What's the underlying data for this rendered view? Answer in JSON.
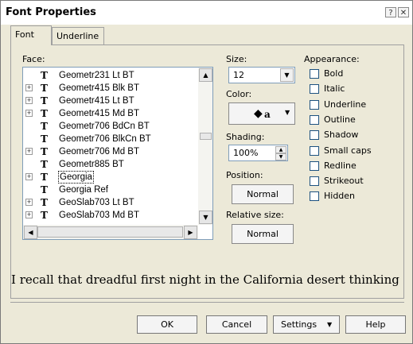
{
  "window": {
    "title": "Font Properties",
    "help_glyph": "?",
    "close_glyph": "✕"
  },
  "tabs": [
    {
      "label": "Font"
    },
    {
      "label": "Underline"
    }
  ],
  "face": {
    "label": "Face:",
    "items": [
      {
        "name": "Geometr231 Lt BT",
        "expand": ""
      },
      {
        "name": "Geometr415 Blk BT",
        "expand": "+"
      },
      {
        "name": "Geometr415 Lt BT",
        "expand": "+"
      },
      {
        "name": "Geometr415 Md BT",
        "expand": "+"
      },
      {
        "name": "Geometr706 BdCn BT",
        "expand": ""
      },
      {
        "name": "Geometr706 BlkCn BT",
        "expand": ""
      },
      {
        "name": "Geometr706 Md BT",
        "expand": "+"
      },
      {
        "name": "Geometr885 BT",
        "expand": ""
      },
      {
        "name": "Georgia",
        "expand": "+",
        "selected": true
      },
      {
        "name": "Georgia Ref",
        "expand": ""
      },
      {
        "name": "GeoSlab703 Lt BT",
        "expand": "+"
      },
      {
        "name": "GeoSlab703 Md BT",
        "expand": "+"
      }
    ],
    "tt_glyph": "T"
  },
  "size": {
    "label": "Size:",
    "value": "12"
  },
  "color": {
    "label": "Color:"
  },
  "shading": {
    "label": "Shading:",
    "value": "100%"
  },
  "position": {
    "label": "Position:",
    "value": "Normal"
  },
  "relative_size": {
    "label": "Relative size:",
    "value": "Normal"
  },
  "appearance": {
    "label": "Appearance:",
    "options": [
      "Bold",
      "Italic",
      "Underline",
      "Outline",
      "Shadow",
      "Small caps",
      "Redline",
      "Strikeout",
      "Hidden"
    ]
  },
  "preview_text": "I recall that dreadful first night in the California desert thinking",
  "buttons": {
    "ok": "OK",
    "cancel": "Cancel",
    "settings": "Settings",
    "help": "Help"
  }
}
